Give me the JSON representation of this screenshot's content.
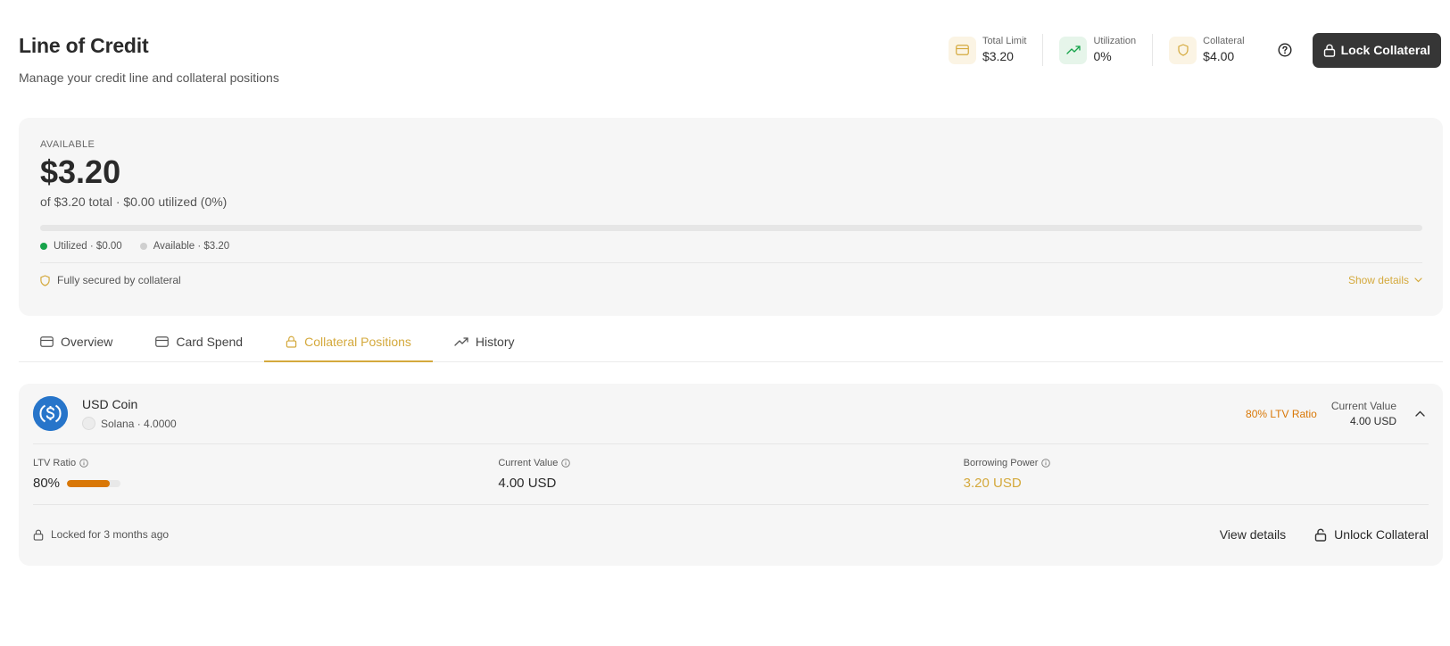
{
  "header": {
    "title": "Line of Credit",
    "subtitle": "Manage your credit line and collateral positions"
  },
  "stats": [
    {
      "label": "Total Limit",
      "value": "$3.20",
      "icon": "credit-card-icon"
    },
    {
      "label": "Utilization",
      "value": "0%",
      "icon": "trending-up-icon"
    },
    {
      "label": "Collateral",
      "value": "$4.00",
      "icon": "shield-icon"
    }
  ],
  "actions": {
    "help_icon": "help-circle-icon",
    "lock_collateral": "Lock Collateral"
  },
  "available": {
    "label": "AVAILABLE",
    "amount": "$3.20",
    "detail": "of $3.20 total · $0.00 utilized (0%)",
    "utilized_fraction": 0,
    "legend_utilized": "Utilized · $0.00",
    "legend_available": "Available · $3.20",
    "secured_text": "Fully secured by collateral",
    "show_details": "Show details"
  },
  "tabs": [
    {
      "label": "Overview",
      "icon": "credit-card-icon",
      "active": false
    },
    {
      "label": "Card Spend",
      "icon": "credit-card-icon",
      "active": false
    },
    {
      "label": "Collateral Positions",
      "icon": "lock-icon",
      "active": true
    },
    {
      "label": "History",
      "icon": "trending-up-icon",
      "active": false
    }
  ],
  "position": {
    "coin_name": "USD Coin",
    "coin_sub": "Solana · 4.0000",
    "ltv_badge": "80% LTV Ratio",
    "current_value_label": "Current Value",
    "current_value": "4.00 USD",
    "metrics": {
      "ltv_label": "LTV Ratio",
      "ltv_value": "80%",
      "ltv_fraction": 0.8,
      "current_value_label": "Current Value",
      "current_value": "4.00 USD",
      "borrowing_label": "Borrowing Power",
      "borrowing_value": "3.20 USD"
    },
    "locked_text": "Locked for 3 months ago",
    "view_details": "View details",
    "unlock": "Unlock Collateral"
  },
  "colors": {
    "accent": "#d4a93c",
    "ltv": "#d97706",
    "utilized": "#16a34a",
    "dark_button": "#363636",
    "usdc": "#2775ca"
  }
}
